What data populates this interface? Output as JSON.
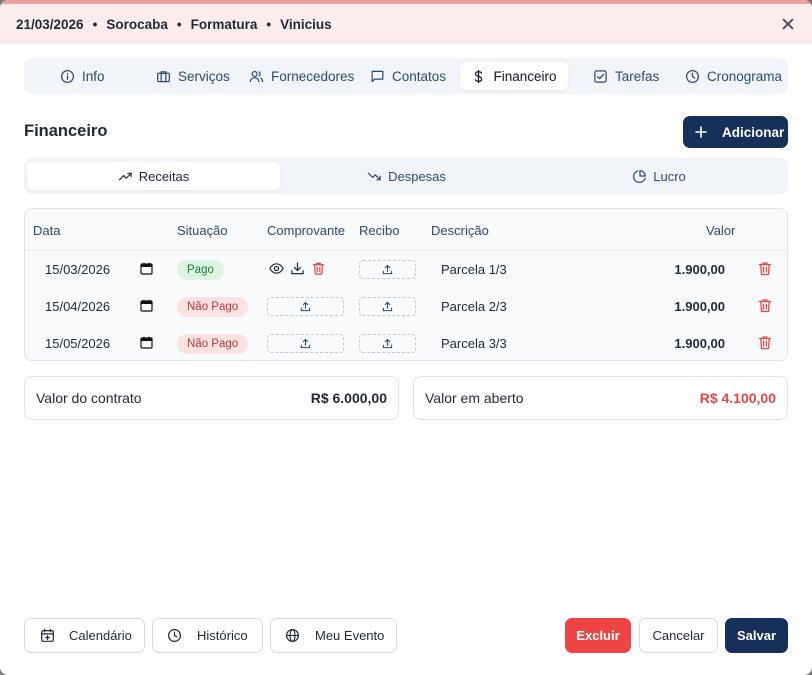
{
  "header": {
    "date": "21/03/2026",
    "city": "Sorocaba",
    "event_type": "Formatura",
    "client": "Vinicius",
    "separator": "•"
  },
  "tabs": [
    {
      "label": "Info",
      "icon": "info-icon"
    },
    {
      "label": "Serviços",
      "icon": "briefcase-icon"
    },
    {
      "label": "Fornecedores",
      "icon": "users-icon"
    },
    {
      "label": "Contatos",
      "icon": "message-icon"
    },
    {
      "label": "Financeiro",
      "icon": "dollar-icon",
      "active": true
    },
    {
      "label": "Tarefas",
      "icon": "checkbox-icon"
    },
    {
      "label": "Cronograma",
      "icon": "clock-icon"
    }
  ],
  "section": {
    "title": "Financeiro",
    "add_label": "Adicionar"
  },
  "subtabs": [
    {
      "label": "Receitas",
      "icon": "trending-up-icon",
      "active": true
    },
    {
      "label": "Despesas",
      "icon": "trending-down-icon"
    },
    {
      "label": "Lucro",
      "icon": "pie-chart-icon"
    }
  ],
  "table": {
    "headers": {
      "data": "Data",
      "situacao": "Situação",
      "comprovante": "Comprovante",
      "recibo": "Recibo",
      "descricao": "Descrição",
      "valor": "Valor"
    },
    "rows": [
      {
        "date": "15/03/2026",
        "status": "Pago",
        "has_receipt": true,
        "description": "Parcela 1/3",
        "value": "1.900,00"
      },
      {
        "date": "15/04/2026",
        "status": "Não Pago",
        "has_receipt": false,
        "description": "Parcela 2/3",
        "value": "1.900,00"
      },
      {
        "date": "15/05/2026",
        "status": "Não Pago",
        "has_receipt": false,
        "description": "Parcela 3/3",
        "value": "1.900,00"
      }
    ]
  },
  "summary": {
    "contract_label": "Valor do contrato",
    "contract_value": "R$ 6.000,00",
    "open_label": "Valor em aberto",
    "open_value": "R$ 4.100,00"
  },
  "footer": {
    "calendar": "Calendário",
    "history": "Histórico",
    "my_event": "Meu Evento",
    "delete": "Excluir",
    "cancel": "Cancelar",
    "save": "Salvar"
  },
  "colors": {
    "primary": "#16305a",
    "danger": "#ef4444",
    "header_bg": "#fdecec",
    "paid_bg": "#dcf5e3",
    "unpaid_bg": "#fde2e2"
  }
}
